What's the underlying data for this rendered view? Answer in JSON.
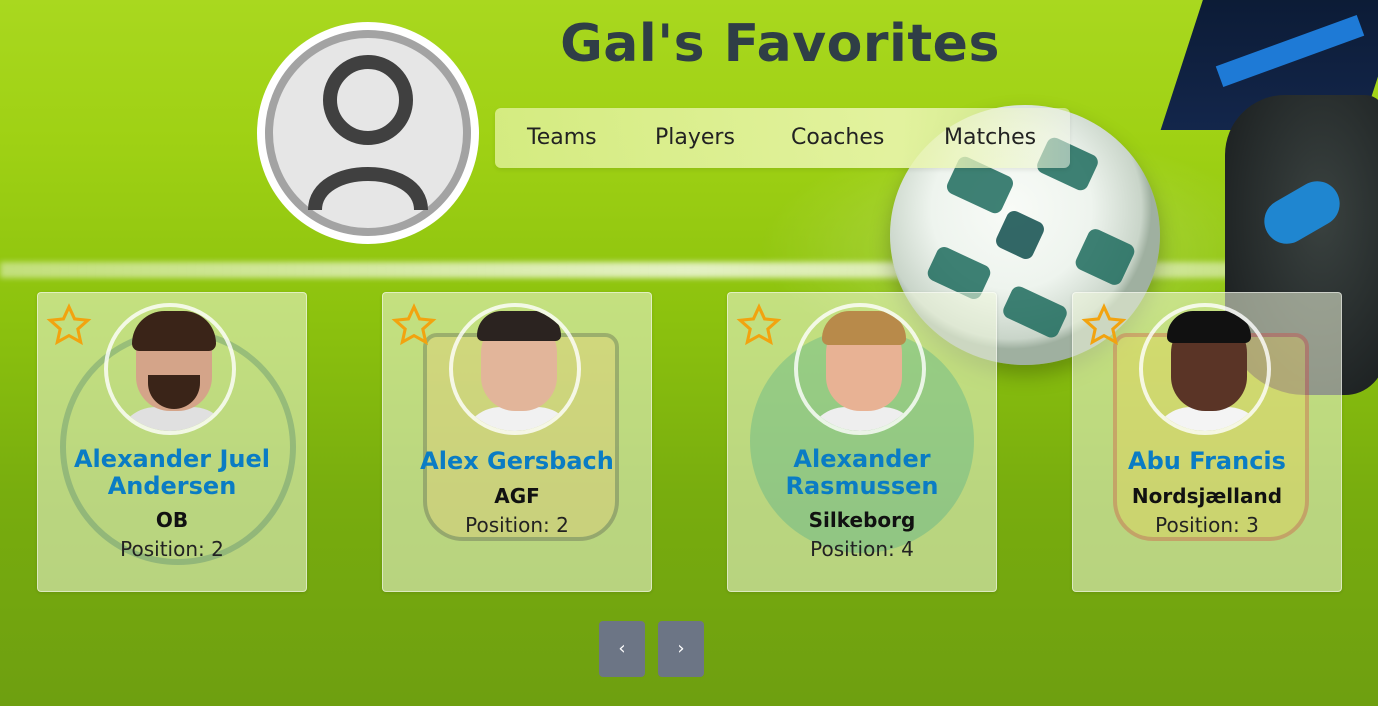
{
  "header": {
    "title": "Gal's Favorites"
  },
  "nav": {
    "items": [
      {
        "label": "Teams"
      },
      {
        "label": "Players"
      },
      {
        "label": "Coaches"
      },
      {
        "label": "Matches"
      }
    ]
  },
  "cards": [
    {
      "name": "Alexander Juel Andersen",
      "team": "OB",
      "position": "Position: 2"
    },
    {
      "name": "Alex Gersbach",
      "team": "AGF",
      "position": "Position: 2"
    },
    {
      "name": "Alexander Rasmussen",
      "team": "Silkeborg",
      "position": "Position: 4"
    },
    {
      "name": "Abu Francis",
      "team": "Nordsjælland",
      "position": "Position: 3"
    }
  ],
  "pager": {
    "prev_label": "‹",
    "next_label": "›"
  },
  "colors": {
    "title": "#2f3e46",
    "player_name": "#0a7cc4",
    "star": "#f2a30f",
    "pager": "#6c7585"
  },
  "icons": [
    "user-icon",
    "star-icon",
    "chevron-left-icon",
    "chevron-right-icon"
  ]
}
